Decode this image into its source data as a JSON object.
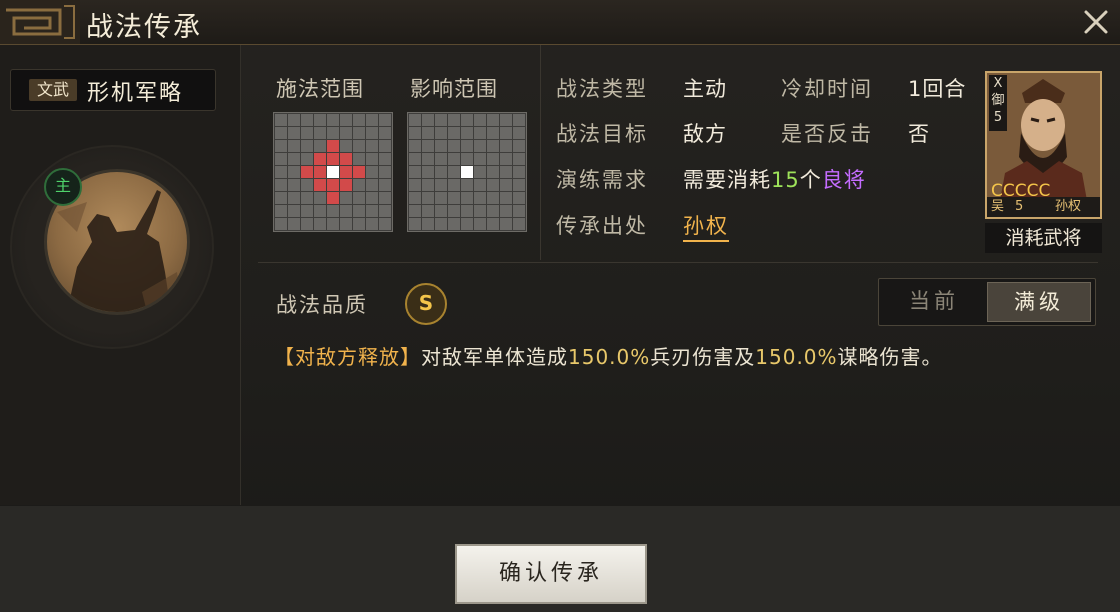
{
  "window": {
    "title": "战法传承"
  },
  "skill": {
    "tag": "文武",
    "name": "形机军略",
    "role_badge": "主"
  },
  "range": {
    "cast_label": "施法范围",
    "effect_label": "影响范围",
    "cast_red_cells": [
      [
        4,
        2
      ],
      [
        3,
        3
      ],
      [
        4,
        3
      ],
      [
        5,
        3
      ],
      [
        2,
        4
      ],
      [
        3,
        4
      ],
      [
        5,
        4
      ],
      [
        6,
        4
      ],
      [
        3,
        5
      ],
      [
        4,
        5
      ],
      [
        5,
        5
      ],
      [
        4,
        6
      ]
    ],
    "cast_white_cells": [
      [
        4,
        4
      ]
    ],
    "effect_white_cells": [
      [
        4,
        4
      ]
    ]
  },
  "info": {
    "type_label": "战法类型",
    "type_value": "主动",
    "cooldown_label": "冷却时间",
    "cooldown_value": "1回合",
    "target_label": "战法目标",
    "target_value": "敌方",
    "counter_label": "是否反击",
    "counter_value": "否",
    "req_label": "演练需求",
    "req_prefix": "需要消耗",
    "req_count": "15",
    "req_unit": "个",
    "req_item": "良将",
    "origin_label": "传承出处",
    "origin_value": "孙权"
  },
  "card": {
    "badge_top": "X",
    "badge_type": "御",
    "badge_num": "5",
    "stars": "CCCCC",
    "faction": "吴",
    "cost": "5",
    "name": "孙权",
    "caption": "消耗武将"
  },
  "quality": {
    "label": "战法品质",
    "grade": "S"
  },
  "level_toggle": {
    "current": "当前",
    "max": "满级"
  },
  "description": {
    "bracket": "【对敌方释放】",
    "p1": "对敌军单体造成",
    "v1": "150.0%",
    "p2": "兵刃伤害及",
    "v2": "150.0%",
    "p3": "谋略伤害。"
  },
  "confirm_button": "确认传承",
  "colors": {
    "highlight_red": "#d24a4a",
    "highlight_white": "#ffffff",
    "gold": "#f1b34c",
    "green": "#9ee35a",
    "purple": "#c46cff"
  }
}
